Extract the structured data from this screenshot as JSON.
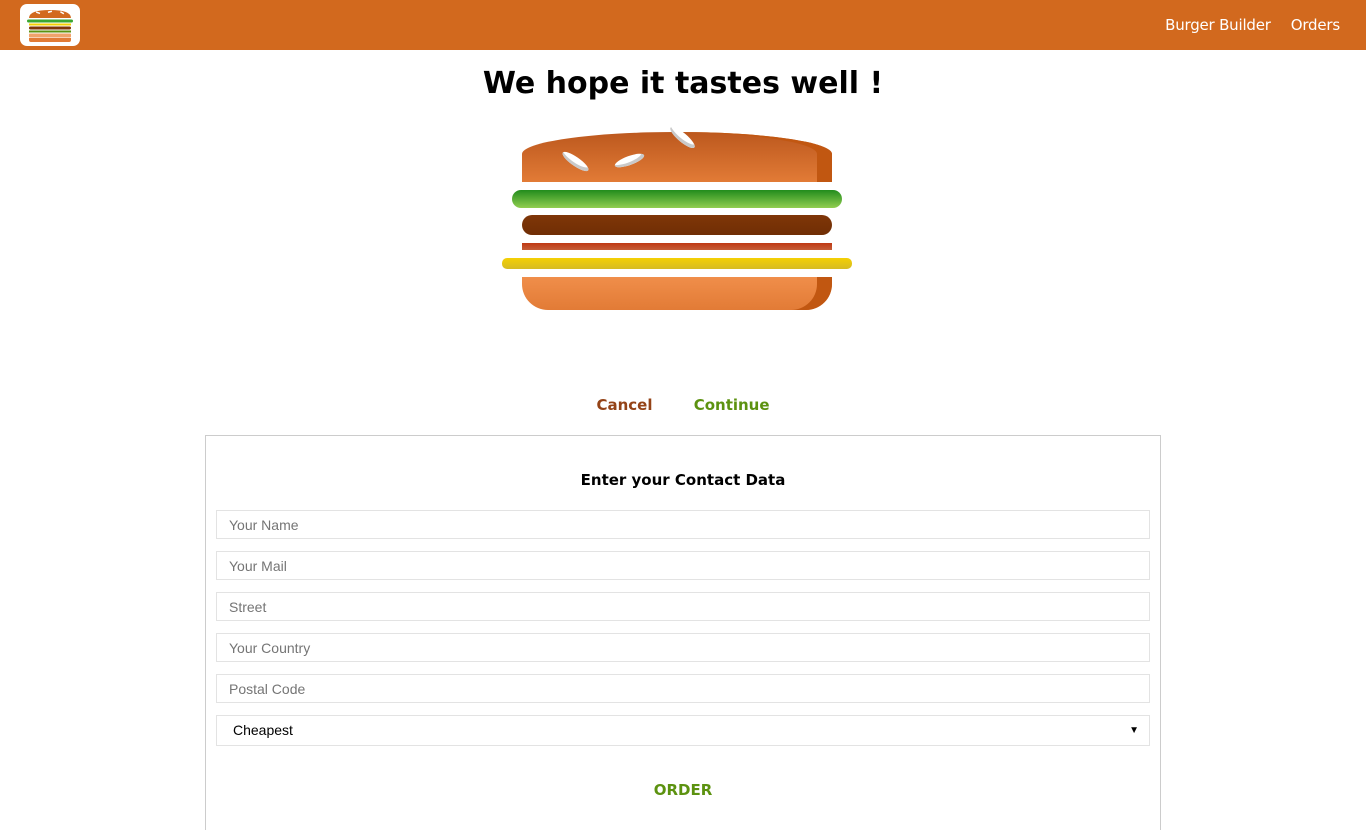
{
  "toolbar": {
    "logo_icon": "burger-logo-icon",
    "nav": [
      {
        "label": "Burger Builder"
      },
      {
        "label": "Orders"
      }
    ],
    "background_color": "#d2691e"
  },
  "checkout": {
    "title": "We hope it tastes well !",
    "cancel_label": "Cancel",
    "continue_label": "Continue",
    "ingredients": [
      "salad",
      "meat",
      "bacon",
      "cheese"
    ]
  },
  "contact": {
    "title": "Enter your Contact Data",
    "fields": [
      {
        "placeholder": "Your Name",
        "value": ""
      },
      {
        "placeholder": "Your Mail",
        "value": ""
      },
      {
        "placeholder": "Street",
        "value": ""
      },
      {
        "placeholder": "Your Country",
        "value": ""
      },
      {
        "placeholder": "Postal Code",
        "value": ""
      }
    ],
    "delivery_method": {
      "selected": "Cheapest",
      "options": [
        "Cheapest"
      ]
    },
    "order_label": "ORDER"
  },
  "colors": {
    "danger": "#944317",
    "success": "#5c9210"
  }
}
